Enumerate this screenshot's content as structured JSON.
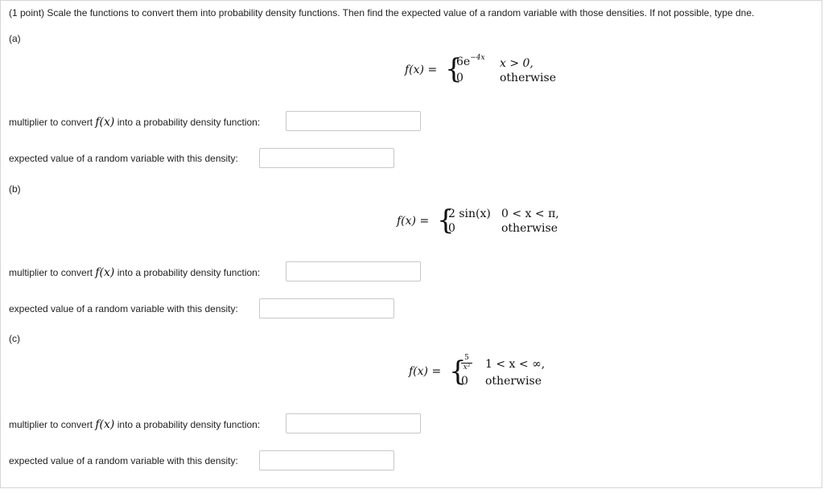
{
  "prompt": "(1 point) Scale the functions to convert them into probability density functions. Then find the expected value of a random variable with those densities. If not possible, type dne.",
  "labels": {
    "multiplier_prefix": "multiplier to convert ",
    "fx": "f(x)",
    "multiplier_suffix": " into a probability density function:",
    "expected": "expected value of a random variable with this density:"
  },
  "parts": [
    {
      "label": "(a)",
      "lhs": "f(x) =",
      "case1_expr_base": "6e",
      "case1_expr_sup": "−4x",
      "case1_cond": "x > 0,",
      "case2_expr": "0",
      "case2_cond": "otherwise",
      "multiplier_value": "",
      "expected_value": ""
    },
    {
      "label": "(b)",
      "lhs": "f(x) =",
      "case1_expr": "2 sin(x)",
      "case1_cond": "0 < x < π,",
      "case2_expr": "0",
      "case2_cond": "otherwise",
      "multiplier_value": "",
      "expected_value": ""
    },
    {
      "label": "(c)",
      "lhs": "f(x) =",
      "case1_frac_num": "5",
      "case1_frac_den": "x²",
      "case1_cond": "1 < x < ∞,",
      "case2_expr": "0",
      "case2_cond": "otherwise",
      "multiplier_value": "",
      "expected_value": ""
    }
  ]
}
